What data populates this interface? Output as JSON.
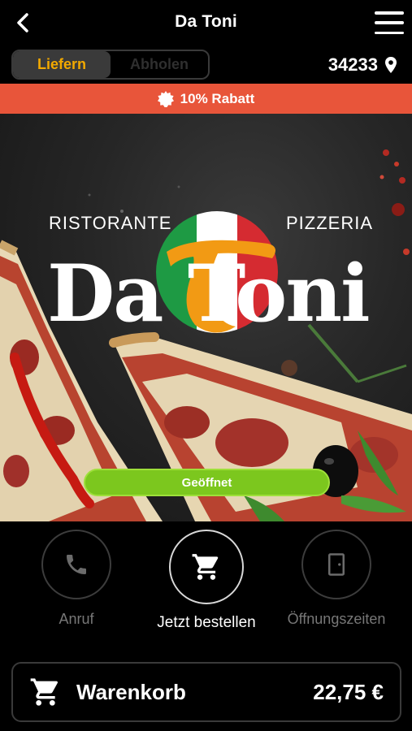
{
  "header": {
    "title": "Da Toni",
    "back_icon": "chevron-left-icon",
    "menu_icon": "hamburger-icon"
  },
  "delivery_toggle": {
    "options": [
      "Liefern",
      "Abholen"
    ],
    "selected": "Liefern",
    "active_color": "#f2a900"
  },
  "location": {
    "postcode": "34233",
    "icon": "map-pin-icon"
  },
  "promo_banner": {
    "text": "10% Rabatt",
    "icon": "badge-icon",
    "color": "#e8553a"
  },
  "hero": {
    "logo_top_left": "RISTORANTE",
    "logo_top_right": "PIZZERIA",
    "logo_name": "Da Toni",
    "status": "Geöffnet",
    "status_color": "#7cc71e"
  },
  "actions": {
    "call_label": "Anruf",
    "order_label": "Jetzt bestellen",
    "hours_label": "Öffnungszeiten"
  },
  "cart": {
    "label": "Warenkorb",
    "total": "22,75 €",
    "icon": "cart-icon"
  }
}
